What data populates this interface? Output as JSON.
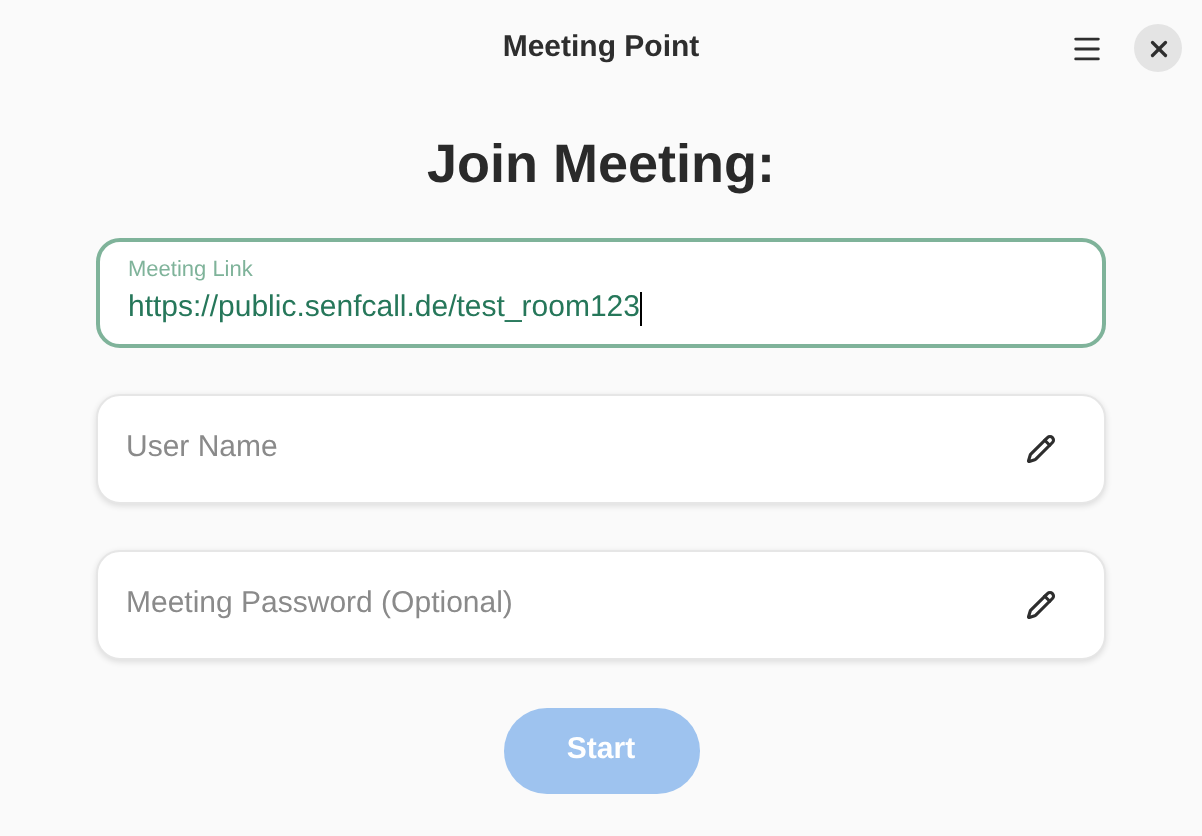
{
  "window": {
    "title": "Meeting Point"
  },
  "heading": "Join Meeting:",
  "fields": [
    {
      "label": "Meeting Link",
      "value": "https://public.senfcall.de/test_room123",
      "focused": true
    },
    {
      "placeholder": "User Name",
      "focused": false
    },
    {
      "placeholder": "Meeting Password (Optional)",
      "focused": false
    }
  ],
  "start_button": {
    "label": "Start",
    "disabled": true
  }
}
